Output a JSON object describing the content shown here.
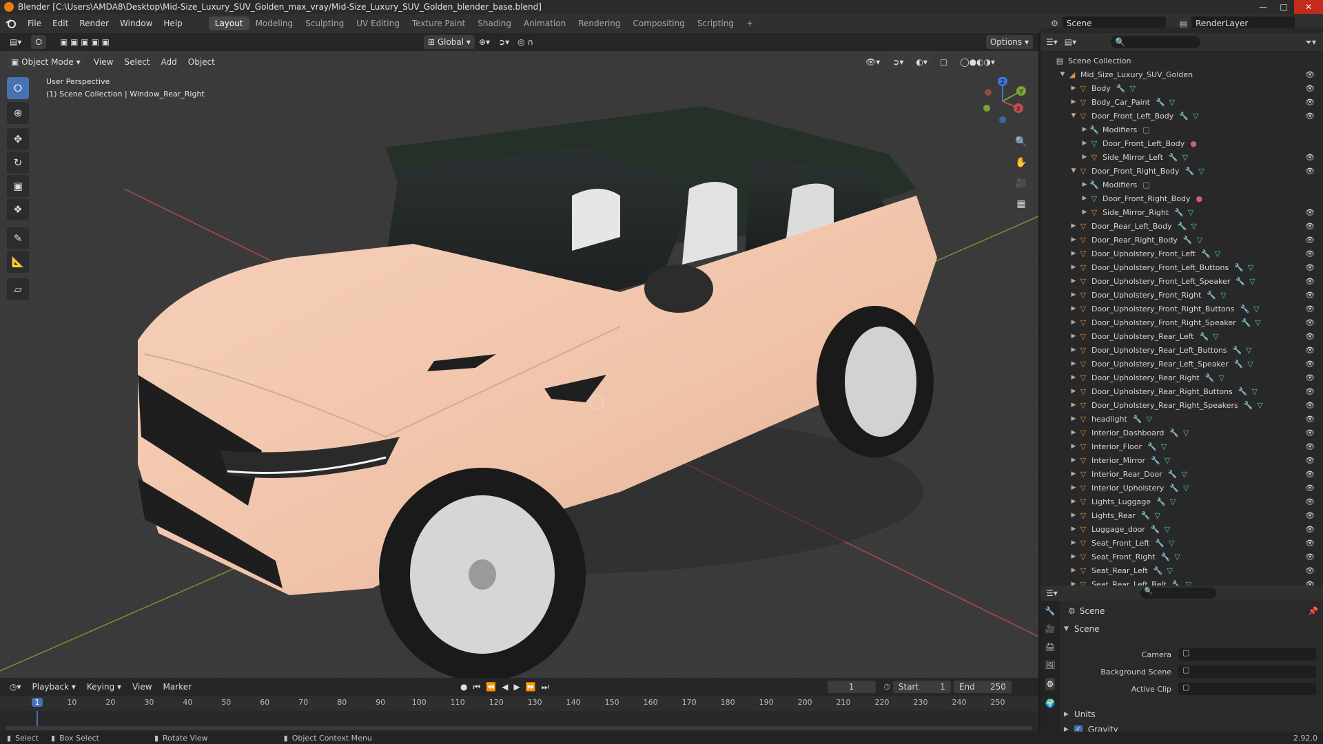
{
  "window": {
    "title": "Blender [C:\\Users\\AMDA8\\Desktop\\Mid-Size_Luxury_SUV_Golden_max_vray/Mid-Size_Luxury_SUV_Golden_blender_base.blend]",
    "minimize": "—",
    "maximize": "□",
    "close": "✕"
  },
  "menu": {
    "items": [
      "File",
      "Edit",
      "Render",
      "Window",
      "Help"
    ],
    "workspaces": [
      "Layout",
      "Modeling",
      "Sculpting",
      "UV Editing",
      "Texture Paint",
      "Shading",
      "Animation",
      "Rendering",
      "Compositing",
      "Scripting"
    ],
    "active_workspace": "Layout",
    "add_workspace": "+",
    "scene": "Scene",
    "render_layer": "RenderLayer"
  },
  "viewport_header": {
    "mode": "Object Mode",
    "menus": [
      "View",
      "Select",
      "Add",
      "Object"
    ],
    "transform_orientation": "Global",
    "options": "Options"
  },
  "viewport": {
    "perspective": "User Perspective",
    "collection_info": "(1) Scene Collection | Window_Rear_Right",
    "gizmo_axes": [
      "Z",
      "Y",
      "X"
    ],
    "colors": {
      "bg": "#3a3a3a",
      "car_body": "#f3c6ad",
      "x_axis": "#c0504d",
      "y_axis": "#7aa33a"
    }
  },
  "outliner": {
    "root": "Scene Collection",
    "collection": "Mid_Size_Luxury_SUV_Golden",
    "items": [
      {
        "label": "Body",
        "level": 1,
        "expanded": false
      },
      {
        "label": "Body_Car_Paint",
        "level": 1,
        "expanded": false
      },
      {
        "label": "Door_Front_Left_Body",
        "level": 1,
        "expanded": true
      },
      {
        "label": "Modifiers",
        "level": 2,
        "type": "modifiers"
      },
      {
        "label": "Door_Front_Left_Body",
        "level": 2,
        "type": "mesh"
      },
      {
        "label": "Side_Mirror_Left",
        "level": 2,
        "expanded": false
      },
      {
        "label": "Door_Front_Right_Body",
        "level": 1,
        "expanded": true
      },
      {
        "label": "Modifiers",
        "level": 2,
        "type": "modifiers"
      },
      {
        "label": "Door_Front_Right_Body",
        "level": 2,
        "type": "mesh"
      },
      {
        "label": "Side_Mirror_Right",
        "level": 2,
        "expanded": false
      },
      {
        "label": "Door_Rear_Left_Body",
        "level": 1,
        "expanded": false
      },
      {
        "label": "Door_Rear_Right_Body",
        "level": 1,
        "expanded": false
      },
      {
        "label": "Door_Upholstery_Front_Left",
        "level": 1,
        "expanded": false
      },
      {
        "label": "Door_Upholstery_Front_Left_Buttons",
        "level": 1,
        "expanded": false
      },
      {
        "label": "Door_Upholstery_Front_Left_Speaker",
        "level": 1,
        "expanded": false
      },
      {
        "label": "Door_Upholstery_Front_Right",
        "level": 1,
        "expanded": false
      },
      {
        "label": "Door_Upholstery_Front_Right_Buttons",
        "level": 1,
        "expanded": false
      },
      {
        "label": "Door_Upholstery_Front_Right_Speaker",
        "level": 1,
        "expanded": false
      },
      {
        "label": "Door_Upholstery_Rear_Left",
        "level": 1,
        "expanded": false
      },
      {
        "label": "Door_Upholstery_Rear_Left_Buttons",
        "level": 1,
        "expanded": false
      },
      {
        "label": "Door_Upholstery_Rear_Left_Speaker",
        "level": 1,
        "expanded": false
      },
      {
        "label": "Door_Upholstery_Rear_Right",
        "level": 1,
        "expanded": false
      },
      {
        "label": "Door_Upholstery_Rear_Right_Buttons",
        "level": 1,
        "expanded": false
      },
      {
        "label": "Door_Upholstery_Rear_Right_Speakers",
        "level": 1,
        "expanded": false
      },
      {
        "label": "headlight",
        "level": 1,
        "expanded": false
      },
      {
        "label": "Interior_Dashboard",
        "level": 1,
        "expanded": false
      },
      {
        "label": "Interior_Floor",
        "level": 1,
        "expanded": false
      },
      {
        "label": "Interior_Mirror",
        "level": 1,
        "expanded": false
      },
      {
        "label": "Interior_Rear_Door",
        "level": 1,
        "expanded": false
      },
      {
        "label": "Interior_Upholstery",
        "level": 1,
        "expanded": false
      },
      {
        "label": "Lights_Luggage",
        "level": 1,
        "expanded": false
      },
      {
        "label": "Lights_Rear",
        "level": 1,
        "expanded": false
      },
      {
        "label": "Luggage_door",
        "level": 1,
        "expanded": false
      },
      {
        "label": "Seat_Front_Left",
        "level": 1,
        "expanded": false
      },
      {
        "label": "Seat_Front_Right",
        "level": 1,
        "expanded": false
      },
      {
        "label": "Seat_Rear_Left",
        "level": 1,
        "expanded": false
      },
      {
        "label": "Seat_Rear_Left_Belt",
        "level": 1,
        "expanded": false
      }
    ]
  },
  "properties": {
    "breadcrumb": "Scene",
    "panel": "Scene",
    "fields": [
      {
        "label": "Camera",
        "value": ""
      },
      {
        "label": "Background Scene",
        "value": ""
      },
      {
        "label": "Active Clip",
        "value": ""
      }
    ],
    "sections": [
      {
        "label": "Units",
        "checked": false
      },
      {
        "label": "Gravity",
        "checked": true
      }
    ]
  },
  "timeline": {
    "menus": [
      "Playback",
      "Keying",
      "View",
      "Marker"
    ],
    "current_frame": "1",
    "start_label": "Start",
    "start": "1",
    "end_label": "End",
    "end": "250",
    "ticks": [
      "1",
      "10",
      "20",
      "30",
      "40",
      "50",
      "60",
      "70",
      "80",
      "90",
      "100",
      "110",
      "120",
      "130",
      "140",
      "150",
      "160",
      "170",
      "180",
      "190",
      "200",
      "210",
      "220",
      "230",
      "240",
      "250"
    ]
  },
  "statusbar": {
    "select": "Select",
    "box_select": "Box Select",
    "rotate_view": "Rotate View",
    "context_menu": "Object Context Menu",
    "version": "2.92.0"
  }
}
